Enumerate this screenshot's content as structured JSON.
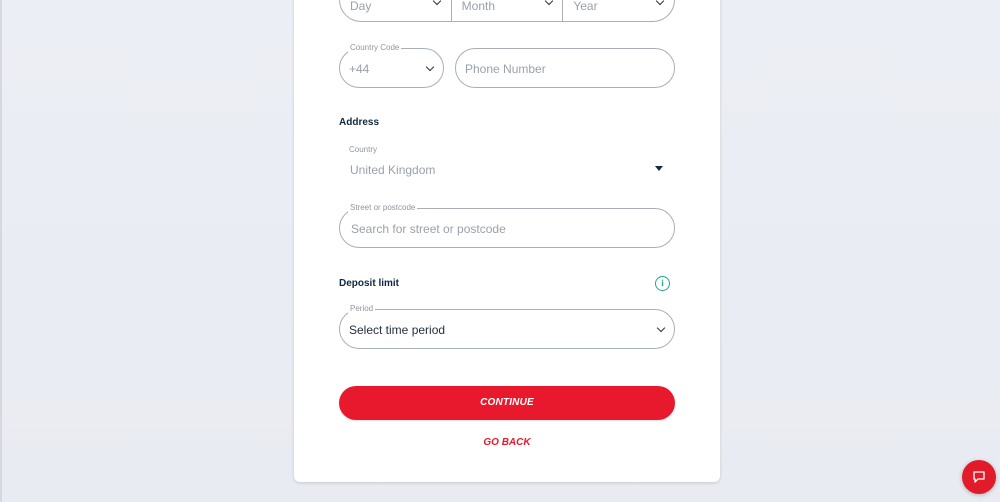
{
  "dob": {
    "day_placeholder": "Day",
    "month_placeholder": "Month",
    "year_placeholder": "Year"
  },
  "phone": {
    "country_code_label": "Country Code",
    "country_code_value": "+44",
    "phone_placeholder": "Phone Number"
  },
  "address": {
    "title": "Address",
    "country_label": "Country",
    "country_value": "United Kingdom",
    "street_label": "Street or postcode",
    "street_placeholder": "Search for street or postcode"
  },
  "deposit": {
    "title": "Deposit limit",
    "info_glyph": "i",
    "period_label": "Period",
    "period_value": "Select time period"
  },
  "actions": {
    "continue_label": "CONTINUE",
    "goback_label": "GO BACK"
  },
  "colors": {
    "accent": "#e8192c",
    "info": "#19a98c",
    "heading": "#10283f"
  },
  "icons": {
    "chevron": "chevron-down-icon",
    "info": "info-icon",
    "chat": "chat-icon"
  }
}
